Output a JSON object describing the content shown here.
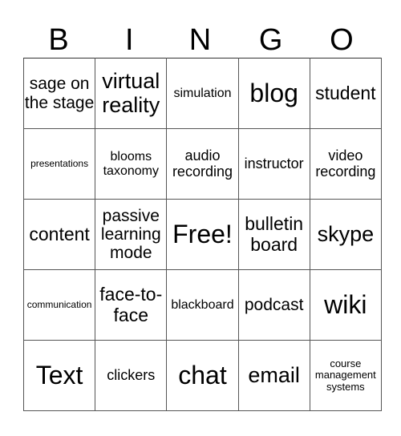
{
  "header": {
    "letters": [
      "B",
      "I",
      "N",
      "G",
      "O"
    ]
  },
  "grid": {
    "rows": [
      [
        {
          "text": "sage on the stage",
          "size": "s20"
        },
        {
          "text": "virtual reality",
          "size": "s26"
        },
        {
          "text": "simulation",
          "size": "s14"
        },
        {
          "text": "blog",
          "size": "s30"
        },
        {
          "text": "student",
          "size": "s22"
        }
      ],
      [
        {
          "text": "presentations",
          "size": "s10"
        },
        {
          "text": "blooms taxonomy",
          "size": "s14"
        },
        {
          "text": "audio recording",
          "size": "s17"
        },
        {
          "text": "instructor",
          "size": "s17"
        },
        {
          "text": "video recording",
          "size": "s17"
        }
      ],
      [
        {
          "text": "content",
          "size": "s22"
        },
        {
          "text": "passive learning mode",
          "size": "s20"
        },
        {
          "text": "Free!",
          "size": "s30"
        },
        {
          "text": "bulletin board",
          "size": "s22"
        },
        {
          "text": "skype",
          "size": "s26"
        }
      ],
      [
        {
          "text": "communication",
          "size": "s10"
        },
        {
          "text": "face-to-face",
          "size": "s22"
        },
        {
          "text": "blackboard",
          "size": "s14"
        },
        {
          "text": "podcast",
          "size": "s20"
        },
        {
          "text": "wiki",
          "size": "s30"
        }
      ],
      [
        {
          "text": "Text",
          "size": "s30"
        },
        {
          "text": "clickers",
          "size": "s17"
        },
        {
          "text": "chat",
          "size": "s30"
        },
        {
          "text": "email",
          "size": "s26"
        },
        {
          "text": "course management systems",
          "size": "s12"
        }
      ]
    ]
  }
}
